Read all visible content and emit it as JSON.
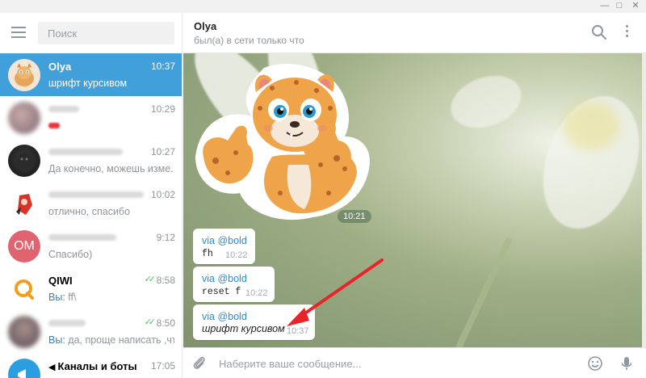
{
  "window": {
    "controls": [
      "—",
      "□",
      "✕"
    ]
  },
  "sidebar": {
    "search_placeholder": "Поиск",
    "chats": [
      {
        "name": "Olya",
        "time": "10:37",
        "preview": "шрифт курсивом",
        "active": true
      },
      {
        "name": "",
        "time": "10:29",
        "preview": "",
        "active": false
      },
      {
        "name": "",
        "time": "10:27",
        "preview": "Да конечно, можешь изме...",
        "active": false
      },
      {
        "name": "",
        "time": "10:02",
        "preview": "отлично, спасибо",
        "active": false
      },
      {
        "name": "",
        "time": "9:12",
        "preview": "Спасибо)",
        "avatar_initials": "OM",
        "active": false
      },
      {
        "name": "QIWI",
        "time": "8:58",
        "you_prefix": "Вы:",
        "preview": " ff\\",
        "active": false
      },
      {
        "name": "",
        "time": "8:50",
        "you_prefix": "Вы:",
        "preview": " да, проще написать ,чт...",
        "active": false
      },
      {
        "name": "Каналы и боты",
        "time": "17:05",
        "preview": "",
        "active": false
      }
    ]
  },
  "header": {
    "name": "Olya",
    "status": "был(а) в сети только что"
  },
  "messages": {
    "sticker_time": "10:21",
    "items": [
      {
        "via": "via @bold",
        "text": "fh",
        "time": "10:22",
        "italic": false
      },
      {
        "via": "via @bold",
        "text": "reset f",
        "time": "10:22",
        "italic": false
      },
      {
        "via": "via @bold",
        "text": "шрифт курсивом",
        "time": "10:37",
        "italic": true
      }
    ]
  },
  "input": {
    "placeholder": "Наберите ваше сообщение..."
  },
  "colors": {
    "accent": "#419fd9",
    "link": "#2f8bd0",
    "arrow": "#e8242a",
    "online_ticks": "#4ec06b",
    "avatar_om": "#e0646f"
  }
}
